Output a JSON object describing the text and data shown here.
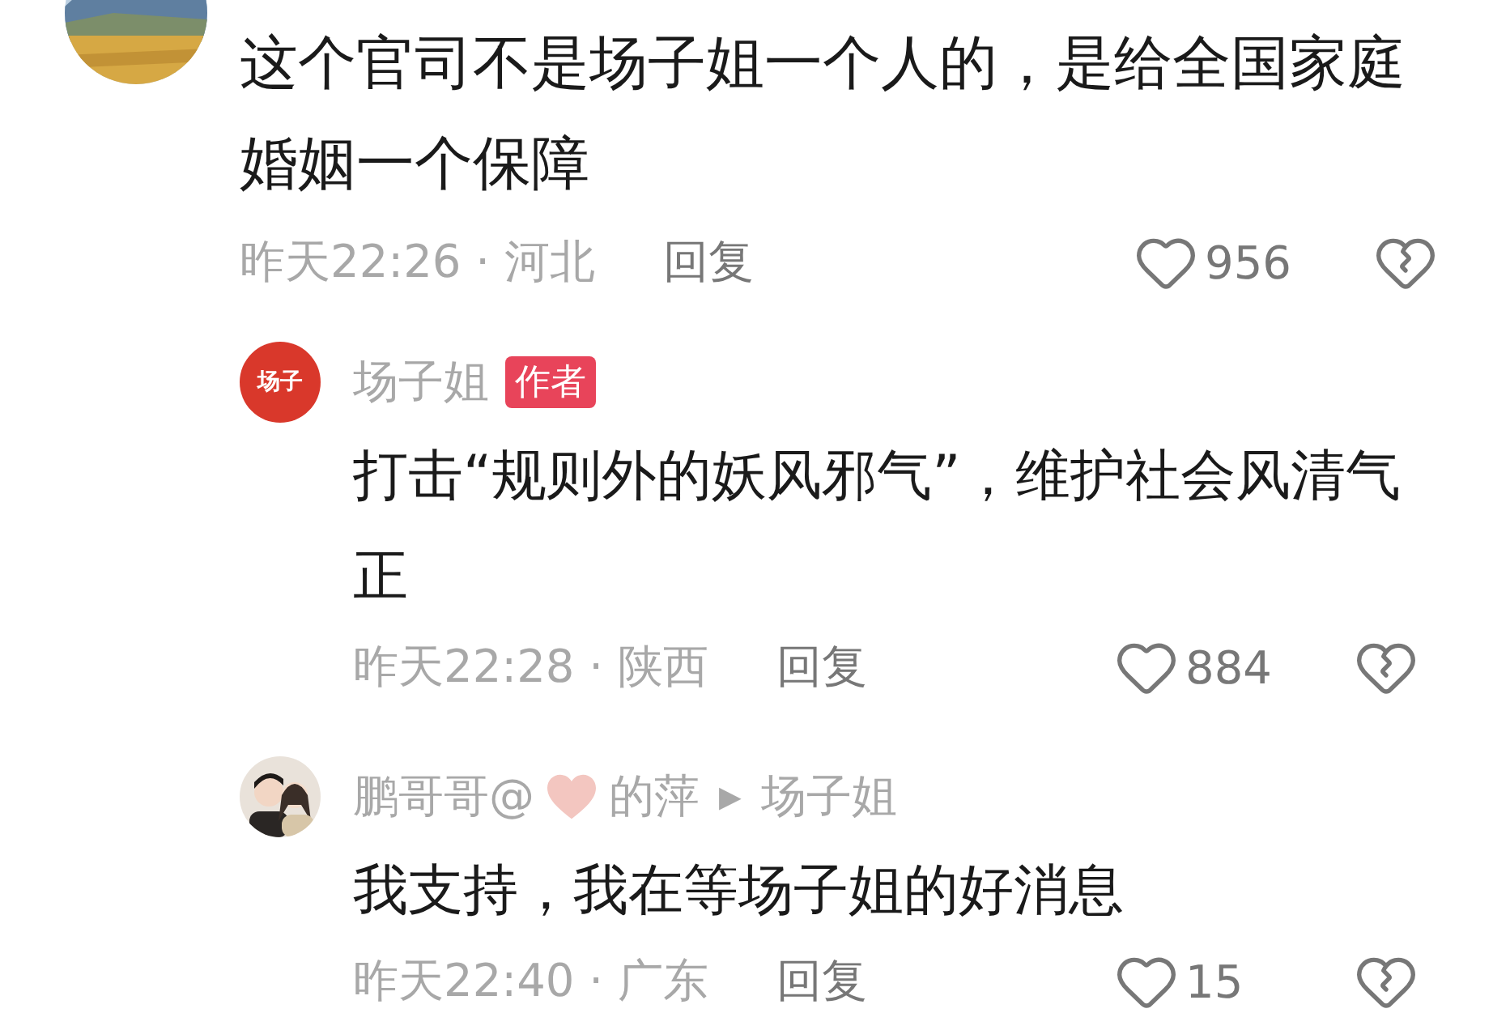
{
  "comment": {
    "text": "这个官司不是场子姐一个人的，是给全国家庭婚姻一个保障",
    "meta": "昨天22:26 · 河北",
    "reply_label": "回复",
    "likes": "956",
    "replies": [
      {
        "kind": "logo",
        "avatar_text": "场子",
        "name": "场子姐",
        "badge": "作者",
        "text": "打击“规则外的妖风邪气”，维护社会风清气正",
        "meta": "昨天22:28 · 陕西",
        "reply_label": "回复",
        "likes": "884"
      },
      {
        "name": "鹏哥哥@",
        "name_after_emoji": "的萍",
        "arrow": "▶",
        "reply_to": "场子姐",
        "text": "我支持，我在等场子姐的好消息",
        "meta": "昨天22:40 · 广东",
        "reply_label": "回复",
        "likes": "15"
      }
    ]
  }
}
